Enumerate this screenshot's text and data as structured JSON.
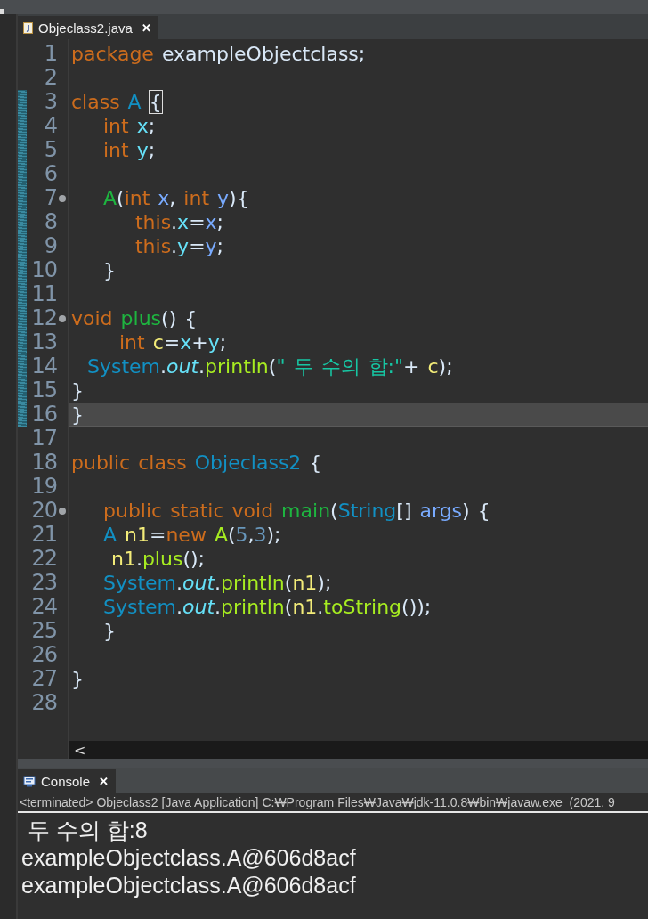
{
  "editor": {
    "tab": {
      "label": "Objeclass2.java",
      "selected": true,
      "close": "✕"
    },
    "lines": [
      {
        "number": "1",
        "fold": false,
        "changed": false,
        "current": false,
        "tokens": [
          {
            "t": "package ",
            "kind": "kw"
          },
          {
            "t": "exampleObjectclass;",
            "kind": "plain"
          }
        ]
      },
      {
        "number": "2",
        "fold": false,
        "changed": false,
        "current": false
      },
      {
        "number": "3",
        "fold": false,
        "changed": true,
        "current": false,
        "tokens": [
          {
            "t": "class ",
            "kind": "kw"
          },
          {
            "t": "A ",
            "kind": "type"
          },
          {
            "t": "{",
            "kind": "match"
          }
        ]
      },
      {
        "number": "4",
        "fold": false,
        "changed": true,
        "current": false,
        "tokens": [
          {
            "t": "    int ",
            "kind": "kw"
          },
          {
            "t": "x",
            "kind": "field"
          },
          {
            "t": ";",
            "kind": "plain"
          }
        ]
      },
      {
        "number": "5",
        "fold": false,
        "changed": true,
        "current": false,
        "tokens": [
          {
            "t": "    int ",
            "kind": "kw"
          },
          {
            "t": "y",
            "kind": "field"
          },
          {
            "t": ";",
            "kind": "plain"
          }
        ]
      },
      {
        "number": "6",
        "fold": false,
        "changed": true,
        "current": false
      },
      {
        "number": "7",
        "fold": true,
        "changed": true,
        "current": false,
        "tokens": [
          {
            "t": "    A",
            "kind": "decl"
          },
          {
            "t": "(",
            "kind": "plain"
          },
          {
            "t": "int ",
            "kind": "kw"
          },
          {
            "t": "x",
            "kind": "param"
          },
          {
            "t": ", ",
            "kind": "plain"
          },
          {
            "t": "int ",
            "kind": "kw"
          },
          {
            "t": "y",
            "kind": "param"
          },
          {
            "t": "){",
            "kind": "plain"
          }
        ]
      },
      {
        "number": "8",
        "fold": false,
        "changed": true,
        "current": false,
        "tokens": [
          {
            "t": "        this",
            "kind": "kw"
          },
          {
            "t": ".",
            "kind": "plain"
          },
          {
            "t": "x",
            "kind": "field"
          },
          {
            "t": "=",
            "kind": "plain"
          },
          {
            "t": "x",
            "kind": "param"
          },
          {
            "t": ";",
            "kind": "plain"
          }
        ]
      },
      {
        "number": "9",
        "fold": false,
        "changed": true,
        "current": false,
        "tokens": [
          {
            "t": "        this",
            "kind": "kw"
          },
          {
            "t": ".",
            "kind": "plain"
          },
          {
            "t": "y",
            "kind": "field"
          },
          {
            "t": "=",
            "kind": "plain"
          },
          {
            "t": "y",
            "kind": "param"
          },
          {
            "t": ";",
            "kind": "plain"
          }
        ]
      },
      {
        "number": "10",
        "fold": false,
        "changed": true,
        "current": false,
        "tokens": [
          {
            "t": "    }",
            "kind": "plain"
          }
        ]
      },
      {
        "number": "11",
        "fold": false,
        "changed": true,
        "current": false
      },
      {
        "number": "12",
        "fold": true,
        "changed": true,
        "current": false,
        "tokens": [
          {
            "t": "void ",
            "kind": "kw"
          },
          {
            "t": "plus",
            "kind": "decl"
          },
          {
            "t": "() {",
            "kind": "plain"
          }
        ]
      },
      {
        "number": "13",
        "fold": false,
        "changed": true,
        "current": false,
        "tokens": [
          {
            "t": "      int ",
            "kind": "kw"
          },
          {
            "t": "c",
            "kind": "local"
          },
          {
            "t": "=",
            "kind": "plain"
          },
          {
            "t": "x",
            "kind": "field"
          },
          {
            "t": "+",
            "kind": "plain"
          },
          {
            "t": "y",
            "kind": "field"
          },
          {
            "t": ";",
            "kind": "plain"
          }
        ]
      },
      {
        "number": "14",
        "fold": false,
        "changed": true,
        "current": false,
        "tokens": [
          {
            "t": "  System",
            "kind": "type"
          },
          {
            "t": ".",
            "kind": "plain"
          },
          {
            "t": "out",
            "kind": "static"
          },
          {
            "t": ".",
            "kind": "plain"
          },
          {
            "t": "println",
            "kind": "method"
          },
          {
            "t": "(",
            "kind": "plain"
          },
          {
            "t": "\" 두 수의 합:\"",
            "kind": "str"
          },
          {
            "t": "+ ",
            "kind": "plain"
          },
          {
            "t": "c",
            "kind": "local"
          },
          {
            "t": ");",
            "kind": "plain"
          }
        ]
      },
      {
        "number": "15",
        "fold": false,
        "changed": true,
        "current": false,
        "tokens": [
          {
            "t": "}",
            "kind": "plain"
          }
        ]
      },
      {
        "number": "16",
        "fold": false,
        "changed": true,
        "current": true,
        "tokens": [
          {
            "t": "}",
            "kind": "plain"
          }
        ]
      },
      {
        "number": "17",
        "fold": false,
        "changed": false,
        "current": false
      },
      {
        "number": "18",
        "fold": false,
        "changed": false,
        "current": false,
        "tokens": [
          {
            "t": "public class ",
            "kind": "kw"
          },
          {
            "t": "Objeclass2",
            "kind": "type"
          },
          {
            "t": " {",
            "kind": "plain"
          }
        ]
      },
      {
        "number": "19",
        "fold": false,
        "changed": false,
        "current": false
      },
      {
        "number": "20",
        "fold": true,
        "changed": false,
        "current": false,
        "tokens": [
          {
            "t": "    public static void ",
            "kind": "kw"
          },
          {
            "t": "main",
            "kind": "decl"
          },
          {
            "t": "(",
            "kind": "plain"
          },
          {
            "t": "String",
            "kind": "type"
          },
          {
            "t": "[] ",
            "kind": "plain"
          },
          {
            "t": "args",
            "kind": "param"
          },
          {
            "t": ") {",
            "kind": "plain"
          }
        ]
      },
      {
        "number": "21",
        "fold": false,
        "changed": false,
        "current": false,
        "tokens": [
          {
            "t": "    A ",
            "kind": "type"
          },
          {
            "t": "n1",
            "kind": "local"
          },
          {
            "t": "=",
            "kind": "plain"
          },
          {
            "t": "new ",
            "kind": "kw"
          },
          {
            "t": "A",
            "kind": "method"
          },
          {
            "t": "(",
            "kind": "plain"
          },
          {
            "t": "5",
            "kind": "num"
          },
          {
            "t": ",",
            "kind": "plain"
          },
          {
            "t": "3",
            "kind": "num"
          },
          {
            "t": ");",
            "kind": "plain"
          }
        ]
      },
      {
        "number": "22",
        "fold": false,
        "changed": false,
        "current": false,
        "tokens": [
          {
            "t": "     n1",
            "kind": "local"
          },
          {
            "t": ".",
            "kind": "plain"
          },
          {
            "t": "plus",
            "kind": "method"
          },
          {
            "t": "();",
            "kind": "plain"
          }
        ]
      },
      {
        "number": "23",
        "fold": false,
        "changed": false,
        "current": false,
        "tokens": [
          {
            "t": "    System",
            "kind": "type"
          },
          {
            "t": ".",
            "kind": "plain"
          },
          {
            "t": "out",
            "kind": "static"
          },
          {
            "t": ".",
            "kind": "plain"
          },
          {
            "t": "println",
            "kind": "method"
          },
          {
            "t": "(",
            "kind": "plain"
          },
          {
            "t": "n1",
            "kind": "local"
          },
          {
            "t": ");",
            "kind": "plain"
          }
        ]
      },
      {
        "number": "24",
        "fold": false,
        "changed": false,
        "current": false,
        "tokens": [
          {
            "t": "    System",
            "kind": "type"
          },
          {
            "t": ".",
            "kind": "plain"
          },
          {
            "t": "out",
            "kind": "static"
          },
          {
            "t": ".",
            "kind": "plain"
          },
          {
            "t": "println",
            "kind": "method"
          },
          {
            "t": "(",
            "kind": "plain"
          },
          {
            "t": "n1",
            "kind": "local"
          },
          {
            "t": ".",
            "kind": "plain"
          },
          {
            "t": "toString",
            "kind": "method"
          },
          {
            "t": "());",
            "kind": "plain"
          }
        ]
      },
      {
        "number": "25",
        "fold": false,
        "changed": false,
        "current": false,
        "tokens": [
          {
            "t": "    }",
            "kind": "plain"
          }
        ]
      },
      {
        "number": "26",
        "fold": false,
        "changed": false,
        "current": false
      },
      {
        "number": "27",
        "fold": false,
        "changed": false,
        "current": false,
        "tokens": [
          {
            "t": "}",
            "kind": "plain"
          }
        ]
      },
      {
        "number": "28",
        "fold": false,
        "changed": false,
        "current": false
      }
    ],
    "scroll_left": "<"
  },
  "console": {
    "tab": {
      "label": "Console",
      "selected": true,
      "close": "✕"
    },
    "header": "<terminated> Objeclass2 [Java Application] C:₩Program Files₩Java₩jdk-11.0.8₩bin₩javaw.exe  (2021. 9",
    "output": [
      " 두 수의 합:8",
      "exampleObjectclass.A@606d8acf",
      "exampleObjectclass.A@606d8acf"
    ]
  }
}
